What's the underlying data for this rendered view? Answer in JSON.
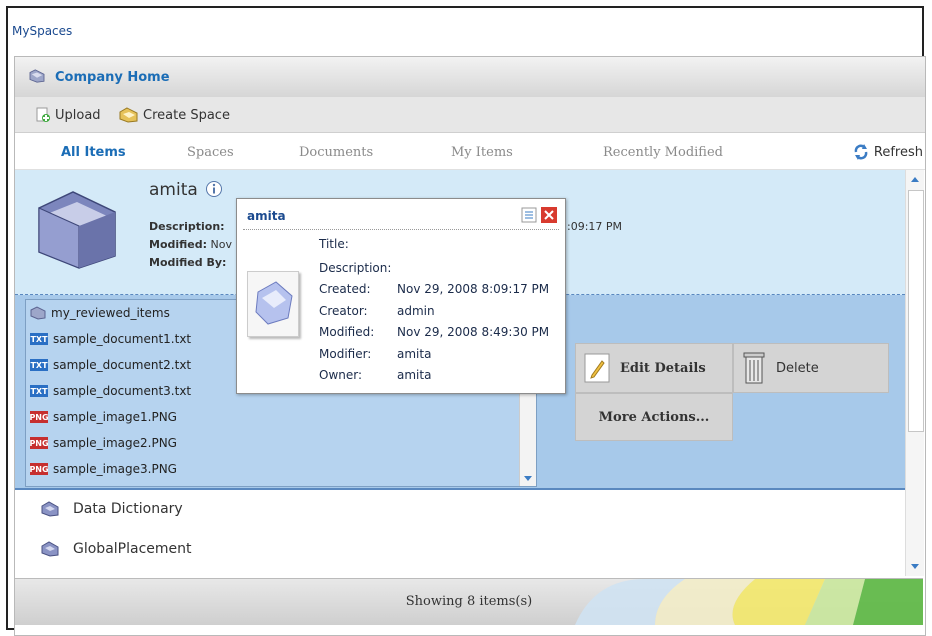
{
  "window": {
    "title": "MySpaces"
  },
  "header": {
    "title": "Company Home"
  },
  "toolbar": {
    "upload_label": "Upload",
    "create_space_label": "Create Space"
  },
  "tabs": [
    {
      "label": "All Items",
      "active": true
    },
    {
      "label": "Spaces"
    },
    {
      "label": "Documents"
    },
    {
      "label": "My Items"
    },
    {
      "label": "Recently Modified"
    }
  ],
  "refresh_label": "Refresh",
  "selected_space": {
    "name": "amita",
    "description_label": "Description:",
    "modified_label": "Modified:",
    "modified_value_partial": "Nov",
    "modified_by_label": "Modified By:",
    "right_time_partial": ":09:17 PM"
  },
  "files": [
    {
      "name": "my_reviewed_items",
      "icon": "folder-icon"
    },
    {
      "name": "sample_document1.txt",
      "icon": "txt-icon"
    },
    {
      "name": "sample_document2.txt",
      "icon": "txt-icon"
    },
    {
      "name": "sample_document3.txt",
      "icon": "txt-icon"
    },
    {
      "name": "sample_image1.PNG",
      "icon": "png-icon"
    },
    {
      "name": "sample_image2.PNG",
      "icon": "png-icon"
    },
    {
      "name": "sample_image3.PNG",
      "icon": "png-icon"
    }
  ],
  "actions": {
    "edit_details": "Edit Details",
    "delete": "Delete",
    "more_actions": "More Actions..."
  },
  "other_spaces": [
    {
      "name": "Data Dictionary"
    },
    {
      "name": "GlobalPlacement"
    }
  ],
  "footer": {
    "status": "Showing 8 items(s)"
  },
  "popup": {
    "title": "amita",
    "fields": [
      {
        "label": "Title:",
        "value": ""
      },
      {
        "label": "Description:",
        "value": ""
      },
      {
        "label": "Created:",
        "value": "Nov 29, 2008 8:09:17 PM"
      },
      {
        "label": "Creator:",
        "value": "admin"
      },
      {
        "label": "Modified:",
        "value": "Nov 29, 2008 8:49:30 PM"
      },
      {
        "label": "Modifier:",
        "value": "amita"
      },
      {
        "label": "Owner:",
        "value": "amita"
      }
    ]
  },
  "colors": {
    "link_blue": "#1b6db6",
    "selection_bg": "#d4eaf8",
    "expanded_bg": "#a7c9ea",
    "close_red": "#d83a2e"
  }
}
